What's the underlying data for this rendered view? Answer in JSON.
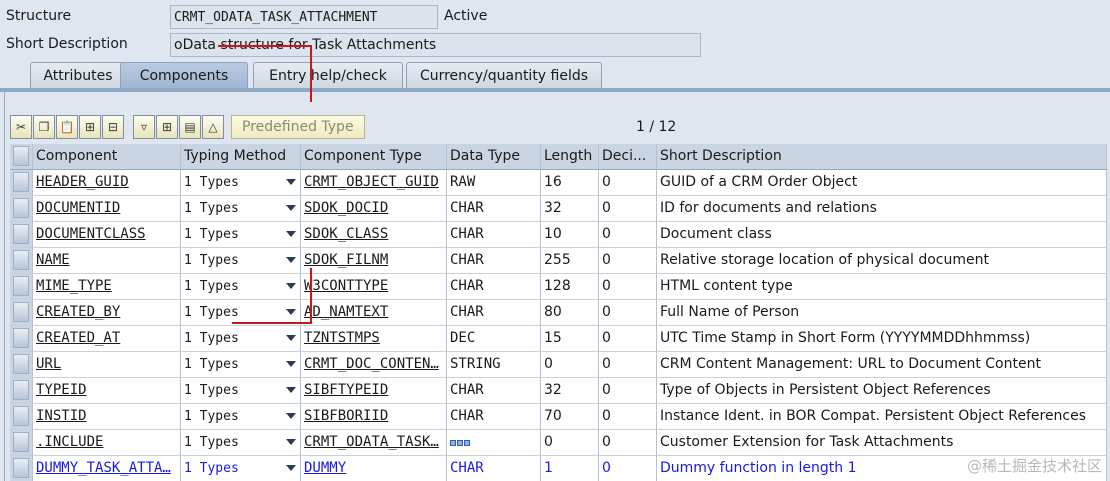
{
  "header": {
    "structure_label": "Structure",
    "structure_value": "CRMT_ODATA_TASK_ATTACHMENT",
    "status": "Active",
    "shortdesc_label": "Short Description",
    "shortdesc_value": "oData structure for Task Attachments"
  },
  "tabs": [
    {
      "label": "Attributes"
    },
    {
      "label": "Components"
    },
    {
      "label": "Entry help/check"
    },
    {
      "label": "Currency/quantity fields"
    }
  ],
  "toolbar": {
    "predefined_type": "Predefined Type",
    "pager": "1 / 12"
  },
  "columns": [
    "Component",
    "Typing Method",
    "Component Type",
    "Data Type",
    "Length",
    "Deci...",
    "Short Description"
  ],
  "rows": [
    {
      "component": "HEADER_GUID",
      "typing": "1 Types",
      "comp_type": "CRMT_OBJECT_GUID",
      "data_type": "RAW",
      "length": "16",
      "dec": "0",
      "desc": "GUID of a CRM Order Object"
    },
    {
      "component": "DOCUMENTID",
      "typing": "1 Types",
      "comp_type": "SDOK_DOCID",
      "data_type": "CHAR",
      "length": "32",
      "dec": "0",
      "desc": "ID for documents and relations"
    },
    {
      "component": "DOCUMENTCLASS",
      "typing": "1 Types",
      "comp_type": "SDOK_CLASS",
      "data_type": "CHAR",
      "length": "10",
      "dec": "0",
      "desc": "Document class"
    },
    {
      "component": "NAME",
      "typing": "1 Types",
      "comp_type": "SDOK_FILNM",
      "data_type": "CHAR",
      "length": "255",
      "dec": "0",
      "desc": "Relative storage location of physical document"
    },
    {
      "component": "MIME_TYPE",
      "typing": "1 Types",
      "comp_type": "W3CONTTYPE",
      "data_type": "CHAR",
      "length": "128",
      "dec": "0",
      "desc": "HTML content type"
    },
    {
      "component": "CREATED_BY",
      "typing": "1 Types",
      "comp_type": "AD_NAMTEXT",
      "data_type": "CHAR",
      "length": "80",
      "dec": "0",
      "desc": "Full Name of Person"
    },
    {
      "component": "CREATED_AT",
      "typing": "1 Types",
      "comp_type": "TZNTSTMPS",
      "data_type": "DEC",
      "length": "15",
      "dec": "0",
      "desc": "UTC Time Stamp in Short Form (YYYYMMDDhhmmss)"
    },
    {
      "component": "URL",
      "typing": "1 Types",
      "comp_type": "CRMT_DOC_CONTEN…",
      "data_type": "STRING",
      "length": "0",
      "dec": "0",
      "desc": "CRM Content Management: URL to Document Content"
    },
    {
      "component": "TYPEID",
      "typing": "1 Types",
      "comp_type": "SIBFTYPEID",
      "data_type": "CHAR",
      "length": "32",
      "dec": "0",
      "desc": "Type of Objects in Persistent Object References"
    },
    {
      "component": "INSTID",
      "typing": "1 Types",
      "comp_type": "SIBFBORIID",
      "data_type": "CHAR",
      "length": "70",
      "dec": "0",
      "desc": "Instance Ident. in BOR Compat. Persistent Object References"
    },
    {
      "component": ".INCLUDE",
      "typing": "1 Types",
      "comp_type": "CRMT_ODATA_TASK…",
      "data_type": "",
      "length": "0",
      "dec": "0",
      "desc": "Customer Extension for Task Attachments"
    },
    {
      "component": "DUMMY_TASK_ATTA…",
      "typing": "1 Types",
      "comp_type": "DUMMY",
      "data_type": "CHAR",
      "length": "1",
      "dec": "0",
      "desc": "Dummy function in length 1"
    }
  ],
  "watermark": "@稀土掘金技术社区"
}
